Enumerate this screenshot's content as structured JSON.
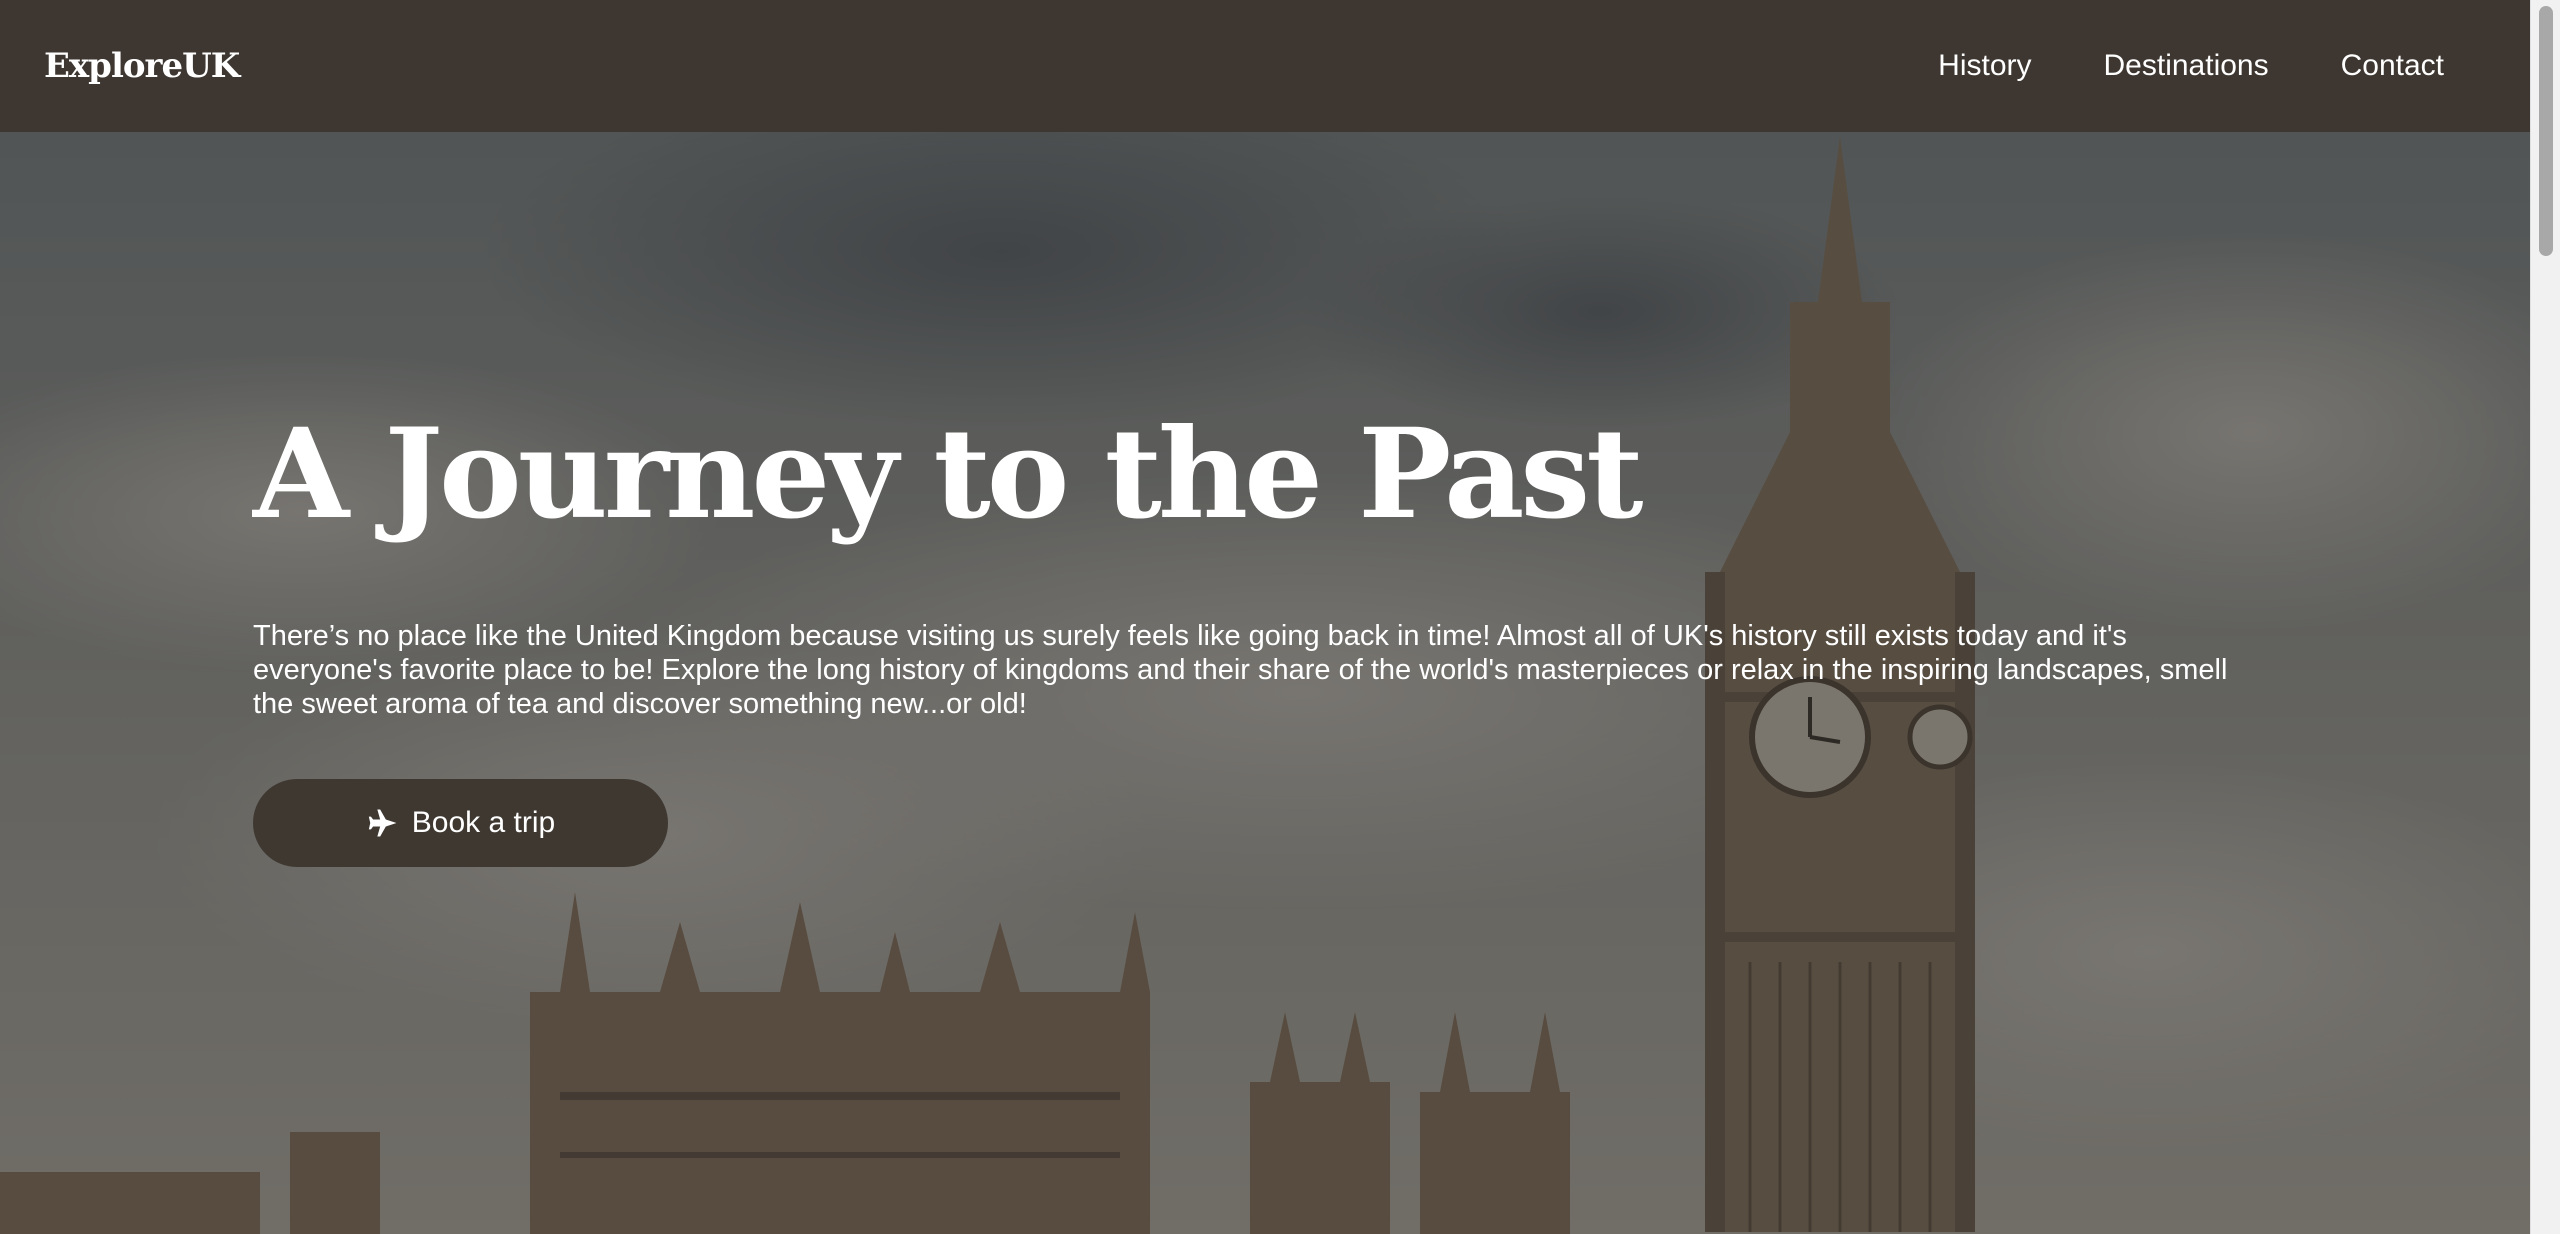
{
  "brand": {
    "logo": "ExploreUK"
  },
  "nav": {
    "links": [
      {
        "label": "History"
      },
      {
        "label": "Destinations"
      },
      {
        "label": "Contact"
      }
    ]
  },
  "hero": {
    "title": "A Journey to the Past",
    "description": "There’s no place like the United Kingdom because visiting us surely feels like going back in time! Almost all of UK's history still exists today and it's everyone's favorite place to be! Explore the long history of kingdoms and their share of the world's masterpieces or relax in the inspiring landscapes, smell the sweet aroma of tea and discover something new...or old!",
    "button_label": "Book a trip",
    "button_icon": "plane-icon"
  },
  "colors": {
    "navbar": "#3e3731",
    "button": "#3e3831",
    "text": "#ffffff"
  }
}
